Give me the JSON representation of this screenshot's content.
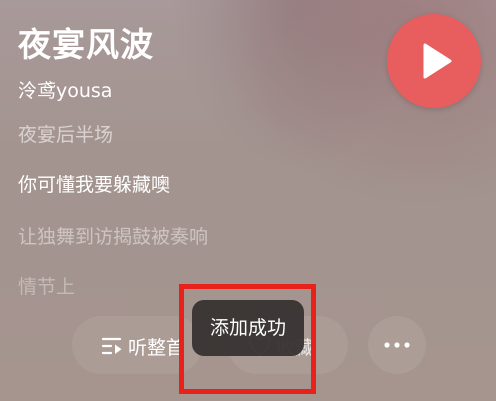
{
  "song": {
    "title": "夜宴风波",
    "artist": "泠鸢yousa"
  },
  "lyrics": [
    "夜宴后半场",
    "你可懂我要躲藏噢",
    "让独舞到访揭鼓被奏响",
    "情节上"
  ],
  "actions": {
    "listen_label": "听整首",
    "favorite_label": "收藏"
  },
  "toast": {
    "message": "添加成功"
  },
  "colors": {
    "play_button": "#e85d5d",
    "highlight_box": "#e8211a",
    "toast_bg": "#373232"
  },
  "icons": {
    "play": "play-icon",
    "listen": "playlist-icon",
    "favorite": "heart-icon",
    "more": "more-icon"
  }
}
